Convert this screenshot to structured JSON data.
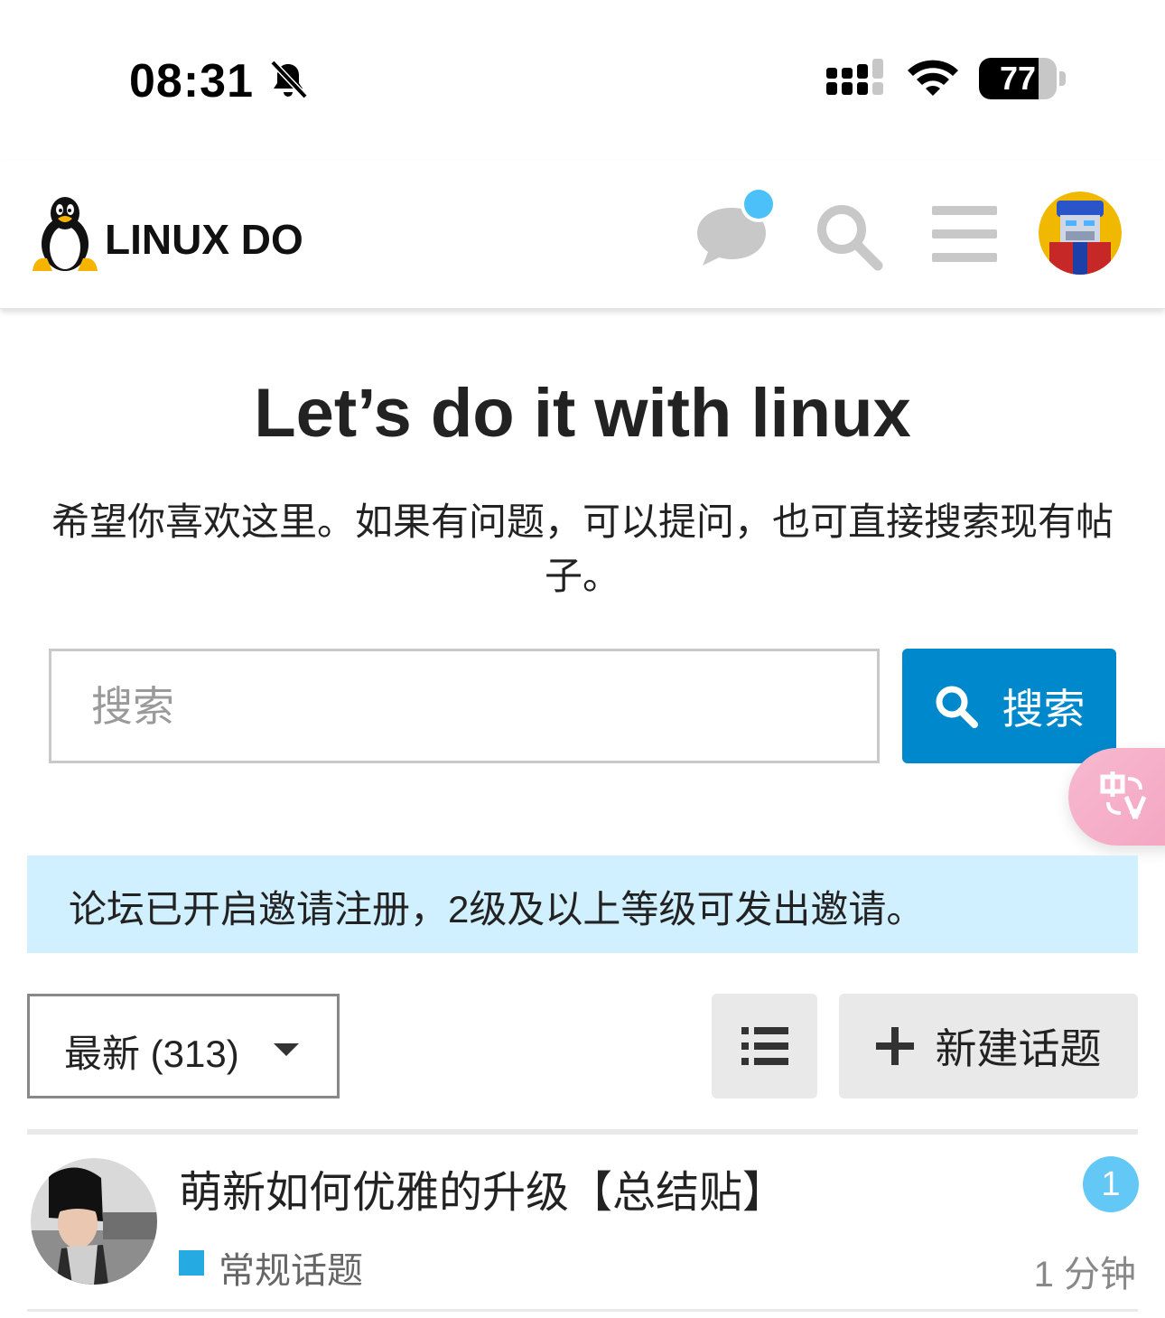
{
  "status_bar": {
    "time": "08:31",
    "battery_level": "77",
    "battery_fraction": 0.77
  },
  "header": {
    "logo_text": "LINUX DO",
    "has_unread_chat": true,
    "icons": [
      "penguin-icon",
      "chat-bubble-icon",
      "search-icon",
      "hamburger-menu-icon",
      "avatar"
    ]
  },
  "hero": {
    "title": "Let’s do it with linux",
    "subtitle": "希望你喜欢这里。如果有问题，可以提问，也可直接搜索现有帖子。"
  },
  "search": {
    "placeholder": "搜索",
    "button_label": "搜索"
  },
  "banner": {
    "text": "论坛已开启邀请注册，2级及以上等级可发出邀请。"
  },
  "controls": {
    "filter_label": "最新 (313)",
    "new_topic_label": "新建话题"
  },
  "topics": [
    {
      "title": "萌新如何优雅的升级【总结贴】",
      "category": "常规话题",
      "category_color": "#25aae2",
      "replies": "1",
      "age": "1 分钟"
    }
  ],
  "colors": {
    "accent": "#0088cc",
    "banner_bg": "#d1f0ff",
    "badge": "#63c8f5",
    "unread_dot": "#4cc1f9"
  }
}
